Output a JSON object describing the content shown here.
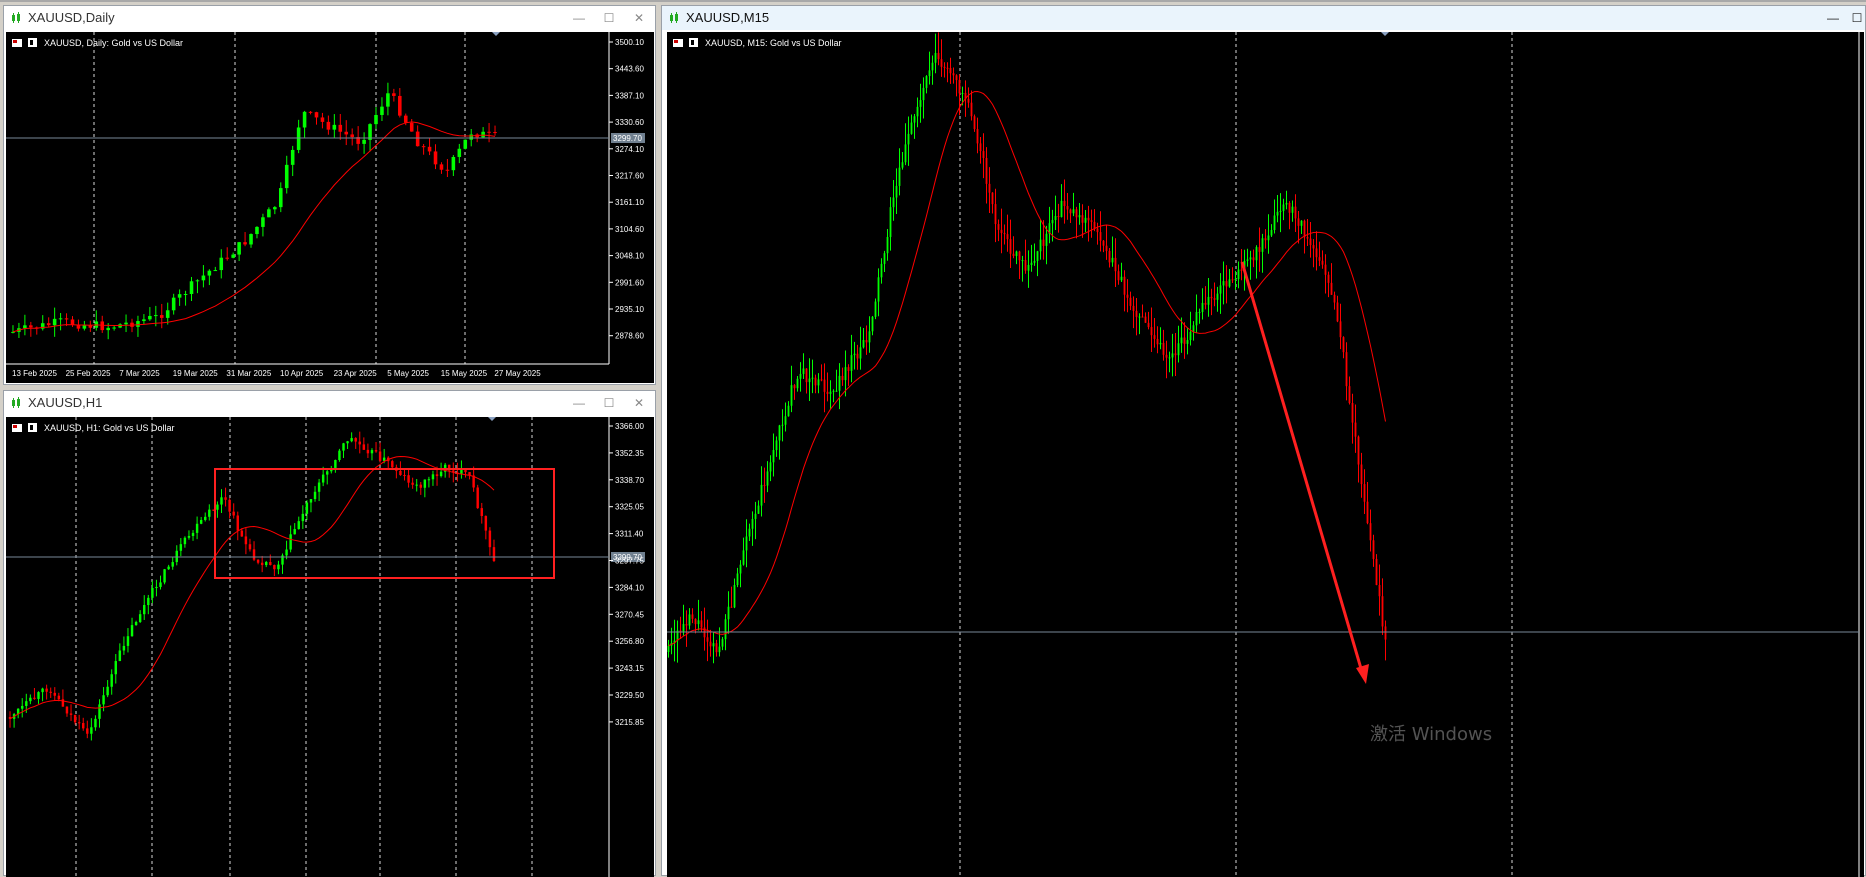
{
  "colors": {
    "bull": "#00ff00",
    "bear": "#ff0000",
    "grid": "#ffffff",
    "bg": "#000000",
    "ma": "#ff0000",
    "axis": "#ffffff",
    "price_line": "#778899",
    "tag_bg": "#708090",
    "highlight": "#ff2020"
  },
  "windows": [
    {
      "id": "daily",
      "title": "XAUUSD,Daily",
      "chart_label": "XAUUSD, Daily:  Gold vs US Dollar",
      "current_price": "3299.70",
      "y_ticks": [
        "3500.10",
        "3443.60",
        "3387.10",
        "3330.60",
        "3274.10",
        "3217.60",
        "3161.10",
        "3104.60",
        "3048.10",
        "2991.60",
        "2935.10",
        "2878.60"
      ],
      "x_ticks": [
        "13 Feb 2025",
        "25 Feb 2025",
        "7 Mar 2025",
        "19 Mar 2025",
        "31 Mar 2025",
        "10 Apr 2025",
        "23 Apr 2025",
        "5 May 2025",
        "15 May 2025",
        "27 May 2025"
      ],
      "icons": {
        "symbol": "flag-icon",
        "window": "chart-icon",
        "title": "candle-icon"
      }
    },
    {
      "id": "h1",
      "title": "XAUUSD,H1",
      "chart_label": "XAUUSD, H1:  Gold vs US Dollar",
      "current_price": "3299.70",
      "y_ticks": [
        "3366.00",
        "3352.35",
        "3338.70",
        "3325.05",
        "3311.40",
        "3297.75",
        "3284.10",
        "3270.45",
        "3256.80",
        "3243.15",
        "3229.50",
        "3215.85"
      ],
      "icons": {
        "symbol": "flag-icon",
        "window": "chart-icon",
        "title": "candle-icon"
      }
    },
    {
      "id": "m15",
      "title": "XAUUSD,M15",
      "chart_label": "XAUUSD, M15:  Gold vs US Dollar",
      "watermark": "激活 Windows",
      "icons": {
        "symbol": "flag-icon",
        "window": "chart-icon",
        "title": "candle-icon"
      }
    }
  ],
  "window_buttons": {
    "minimize": "—",
    "maximize": "☐",
    "close": "✕"
  }
}
